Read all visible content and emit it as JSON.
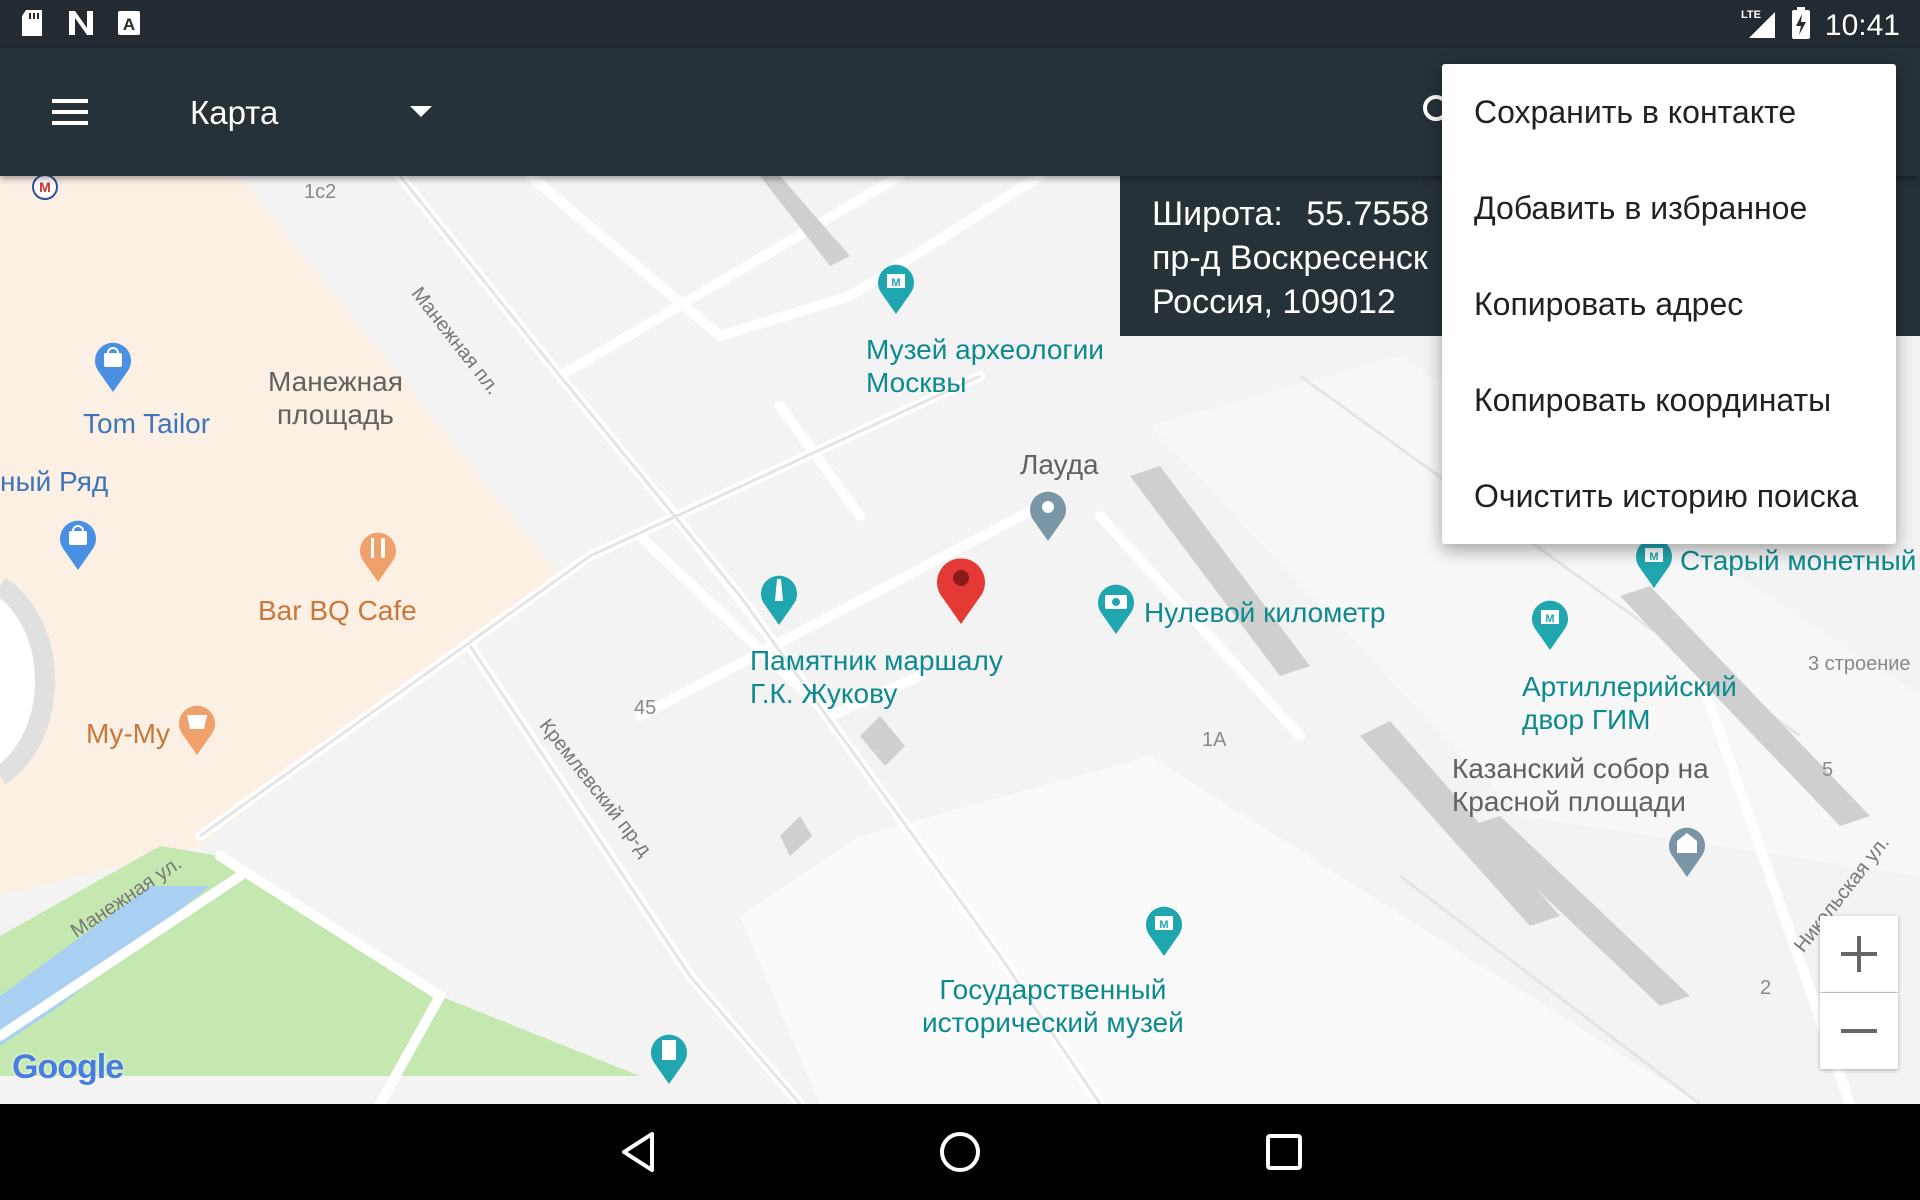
{
  "status_bar": {
    "time": "10:41",
    "network": "LTE"
  },
  "app_bar": {
    "layer_title": "Карта"
  },
  "info_panel": {
    "latitude_label": "Широта:",
    "latitude_value": "55.7558",
    "address_line1": "пр-д Воскресенск",
    "address_line2": "Россия, 109012"
  },
  "overflow_menu": {
    "items": [
      {
        "label": "Сохранить в контакте"
      },
      {
        "label": "Добавить в избранное"
      },
      {
        "label": "Копировать адрес"
      },
      {
        "label": "Копировать координаты"
      },
      {
        "label": "Очистить историю поиска"
      }
    ]
  },
  "map": {
    "places": {
      "museum_archeology": "Музей археологии\nМосквы",
      "lauda": "Лауда",
      "tom_tailor": "Tom Tailor",
      "manezh_square": "Манежная\nплощадь",
      "okhotny_ryad": "ный Ряд",
      "bar_bq_cafe": "Bar BQ Cafe",
      "my_my": "My-My",
      "zhukov_monument": "Памятник маршалу\nГ.К. Жукову",
      "zero_km": "Нулевой километр",
      "old_mint": "Старый монетный",
      "artillery_yard": "Артиллерийский\nдвор ГИМ",
      "kazan_cathedral": "Казанский собор на\nКрасной площади",
      "history_museum": "Государственный\nисторический музей"
    },
    "streets": {
      "manezh_pl": "Манежная пл.",
      "kremlin_pr": "Кремлевский пр-д",
      "manezh_ul": "Манежная ул.",
      "nikolskaya": "Никольская ул."
    },
    "numbers": {
      "n1c2": "1с2",
      "n45": "45",
      "n1a": "1А",
      "n3bld": "3 строение",
      "n5": "5",
      "n2": "2"
    },
    "logo": "Google"
  },
  "colors": {
    "status_bar": "#212b31",
    "app_bar": "#263238",
    "poi_teal": "#0d8a8f",
    "shop_blue": "#3e74b9",
    "food_orange": "#f0a06a",
    "pin_red": "#e53935",
    "park_green": "#c5e8b0"
  }
}
